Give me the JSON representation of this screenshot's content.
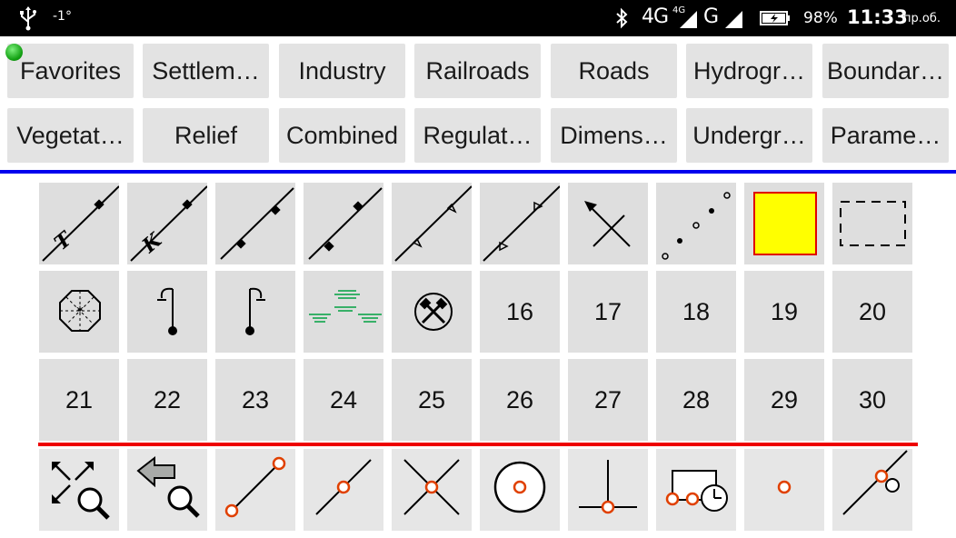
{
  "status_bar": {
    "temperature": "-1°",
    "network_1": "4G",
    "network_1_sup": "4G",
    "network_2": "G",
    "battery_percent": "98%",
    "time": "11:33",
    "day": "пр.об."
  },
  "tabs_row1": [
    "Favorites",
    "Settlem…",
    "Industry",
    "Railroads",
    "Roads",
    "Hydrogr…",
    "Boundar…"
  ],
  "tabs_row2": [
    "Vegetat…",
    "Relief",
    "Combined",
    "Regulat…",
    "Dimens…",
    "Undergr…",
    "Parame…"
  ],
  "grid": {
    "row1_symbols": [
      "line-t-tick-symbol",
      "line-k-tick-symbol",
      "line-ticks-both-symbol",
      "line-ticks-alt-symbol",
      "line-open-triangles-symbol",
      "line-open-triangles-alt-symbol",
      "arrow-cross-symbol",
      "dotted-line-symbol",
      "yellow-filled-square-symbol",
      "dashed-rectangle-symbol"
    ],
    "row2_symbols": [
      "octagon-star-symbol",
      "street-lamp-left-symbol",
      "street-lamp-right-symbol",
      "marsh-symbol",
      "mine-symbol"
    ],
    "row2_numbers": [
      "16",
      "17",
      "18",
      "19",
      "20"
    ],
    "row3_numbers": [
      "21",
      "22",
      "23",
      "24",
      "25",
      "26",
      "27",
      "28",
      "29",
      "30"
    ],
    "fill_color": "#ffff00",
    "marsh_color": "#00a040"
  },
  "tools": [
    "zoom-extents-icon",
    "zoom-back-icon",
    "line-endpoints-icon",
    "line-midpoint-icon",
    "intersection-icon",
    "circle-center-icon",
    "perpendicular-icon",
    "rectangle-rotate-icon",
    "point-icon",
    "line-point-circle-icon"
  ],
  "colors": {
    "accent_blue": "#0000ee",
    "accent_red": "#ee0000",
    "snap_point": "#e04000"
  }
}
